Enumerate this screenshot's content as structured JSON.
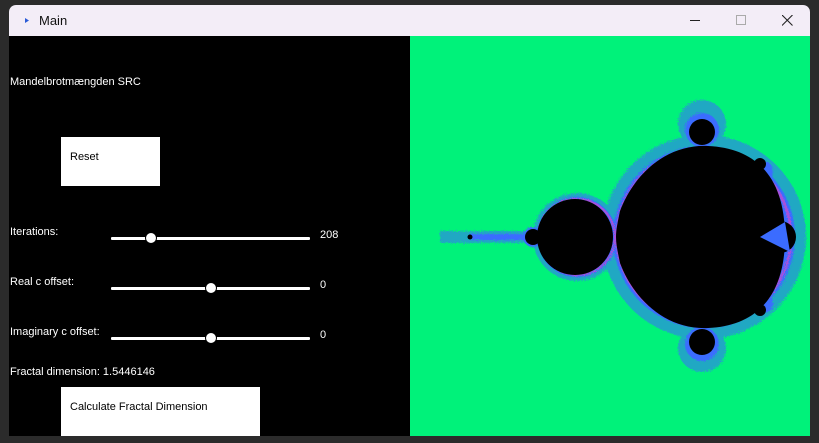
{
  "window": {
    "title": "Main"
  },
  "panel": {
    "title": "Mandelbrotmængden SRC",
    "reset_label": "Reset",
    "iterations": {
      "label": "Iterations:",
      "value": "208",
      "fraction": 0.2
    },
    "real_offset": {
      "label": "Real c offset:",
      "value": "0",
      "fraction": 0.5
    },
    "imag_offset": {
      "label": "Imaginary c offset:",
      "value": "0",
      "fraction": 0.5
    },
    "fractal_dimension": "Fractal dimension: 1.5446146",
    "calc_label": "Calculate Fractal Dimension"
  },
  "colors": {
    "background": "#00f27a",
    "set": "#000000",
    "edge": "#3b6cff",
    "edge_accent": "#c24bd4"
  }
}
